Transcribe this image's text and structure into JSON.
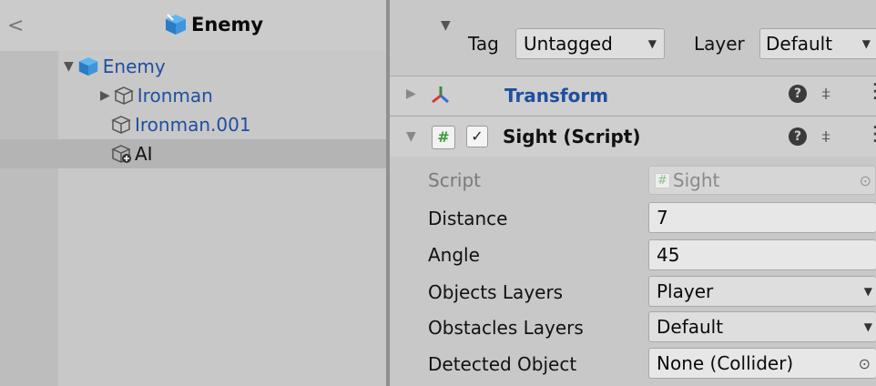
{
  "hierarchy": {
    "back_glyph": "<",
    "header_title": "Enemy",
    "root": {
      "label": "Enemy"
    },
    "children": [
      {
        "label": "Ironman",
        "expandable": true
      },
      {
        "label": "Ironman.001",
        "expandable": false
      },
      {
        "label": "AI",
        "selected": true
      }
    ]
  },
  "inspector": {
    "tag_label": "Tag",
    "tag_value": "Untagged",
    "layer_label": "Layer",
    "layer_value": "Default",
    "components": [
      {
        "name": "Transform",
        "collapsed": true
      },
      {
        "name": "Sight (Script)",
        "collapsed": false,
        "enabled": true
      }
    ],
    "fields": {
      "script": {
        "label": "Script",
        "value": "Sight"
      },
      "distance": {
        "label": "Distance",
        "value": "7"
      },
      "angle": {
        "label": "Angle",
        "value": "45"
      },
      "objects_layers": {
        "label": "Objects Layers",
        "value": "Player"
      },
      "obstacles_layers": {
        "label": "Obstacles Layers",
        "value": "Default"
      },
      "detected_object": {
        "label": "Detected Object",
        "value": "None (Collider)"
      }
    }
  },
  "colors": {
    "accent_blue": "#1f4fa0",
    "panel_bg": "#c8c8c8",
    "field_bg": "#e7e7e7"
  }
}
